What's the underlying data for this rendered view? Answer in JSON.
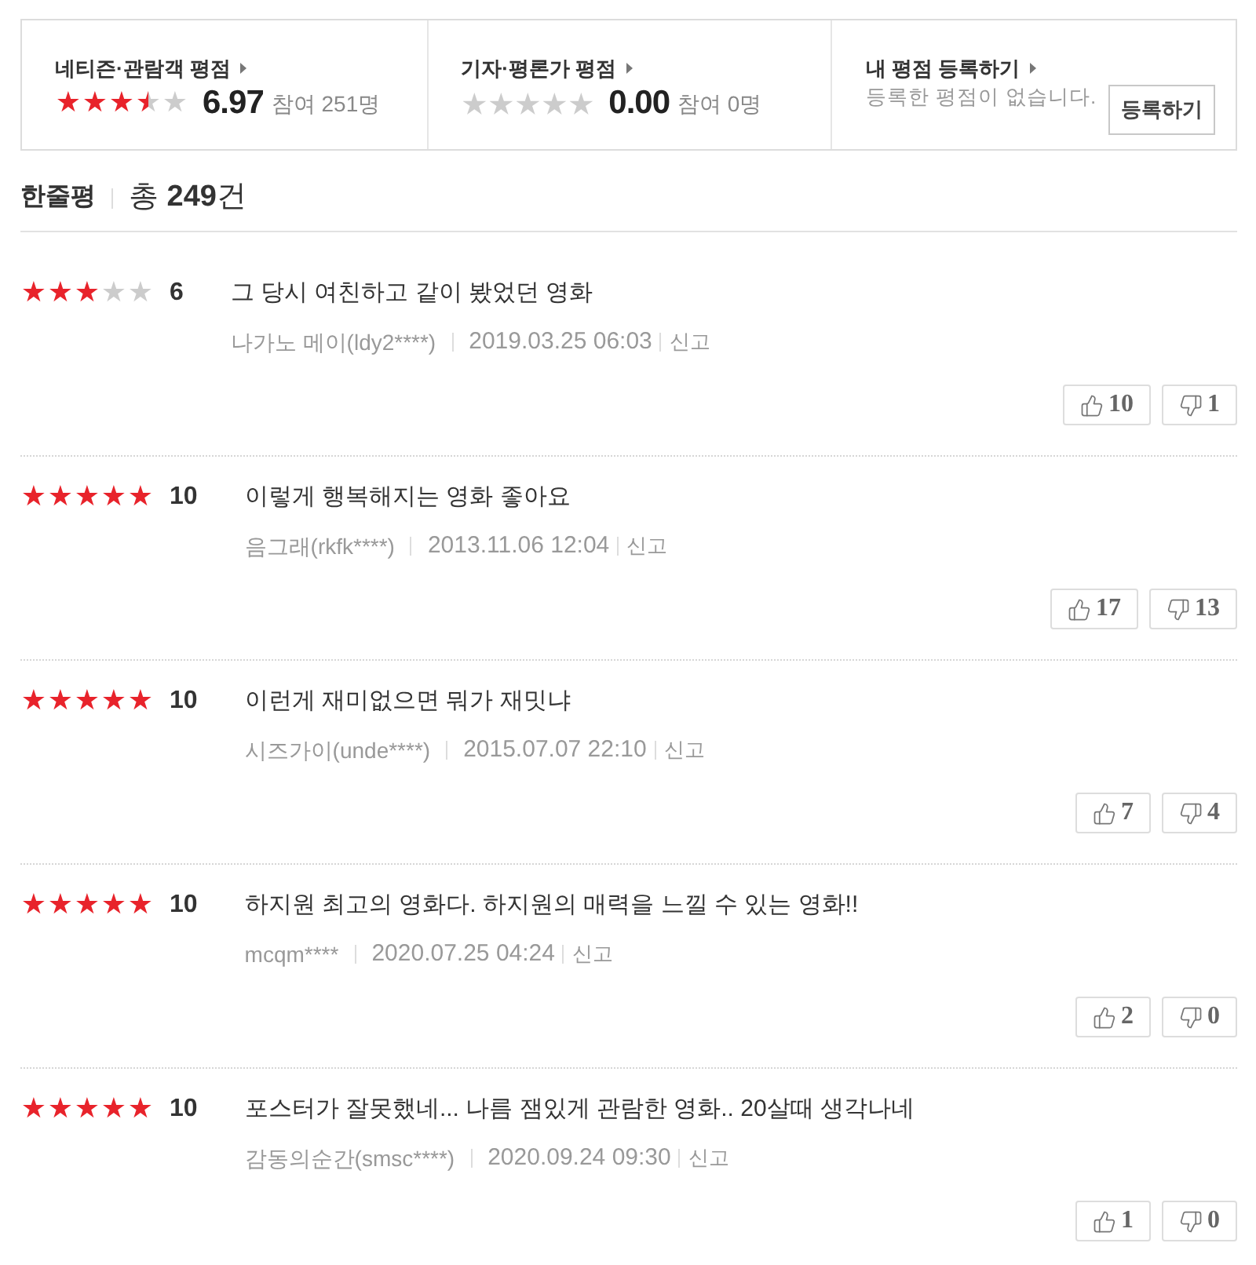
{
  "star_symbol": "★",
  "rating_summary": [
    {
      "title": "네티즌·관람객 평점",
      "stars": 3.5,
      "score": "6.97",
      "participants": "참여 251명"
    },
    {
      "title": "기자·평론가 평점",
      "stars": 0,
      "score": "0.00",
      "participants": "참여 0명"
    }
  ],
  "my_rating": {
    "title": "내 평점 등록하기",
    "message": "등록한 평점이 없습니다.",
    "button": "등록하기"
  },
  "reviews_header": {
    "title": "한줄평",
    "total": "총 **249**건"
  },
  "reviews": [
    {
      "stars": 3,
      "score": "6",
      "text": "그 당시 여친하고 같이 봤었던 영화",
      "author": "나가노 메이(ldy2****)",
      "date": "2019.03.25 06:03",
      "report": "신고",
      "likes": "10",
      "dislikes": "1"
    },
    {
      "stars": 5,
      "score": "10",
      "text": "이렇게 행복해지는 영화 좋아요",
      "author": "음그래(rkfk****)",
      "date": "2013.11.06 12:04",
      "report": "신고",
      "likes": "17",
      "dislikes": "13"
    },
    {
      "stars": 5,
      "score": "10",
      "text": "이런게 재미없으면 뭐가 재밋냐",
      "author": "시즈가이(unde****)",
      "date": "2015.07.07 22:10",
      "report": "신고",
      "likes": "7",
      "dislikes": "4"
    },
    {
      "stars": 5,
      "score": "10",
      "text": "하지원 최고의 영화다. 하지원의 매력을 느낄 수 있는 영화!!",
      "author": "mcqm****",
      "date": "2020.07.25 04:24",
      "report": "신고",
      "likes": "2",
      "dislikes": "0"
    },
    {
      "stars": 5,
      "score": "10",
      "text": "포스터가 잘못했네... 나름 잼있게 관람한 영화.. 20살때 생각나네",
      "author": "감동의순간(smsc****)",
      "date": "2020.09.24 09:30",
      "report": "신고",
      "likes": "1",
      "dislikes": "0"
    }
  ]
}
